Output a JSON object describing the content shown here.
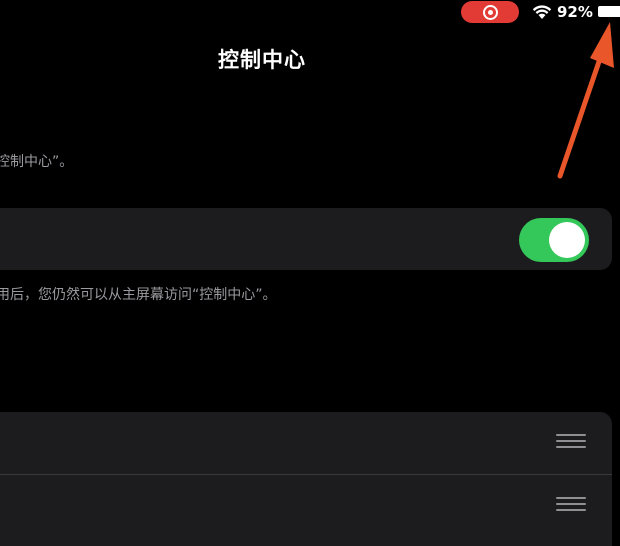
{
  "status_bar": {
    "battery_percent": "92%",
    "recording_color": "#e23a34",
    "icons": [
      "screen-recording-icon",
      "wifi-icon",
      "battery-icon"
    ]
  },
  "header": {
    "title": "控制中心"
  },
  "access_section": {
    "description": "控制中心”。",
    "toggle_on": true,
    "toggle_color": "#34c759",
    "footer": "用后，您仍然可以从主屏幕访问“控制中心”。"
  },
  "list": {
    "rows": [
      {
        "icon": "reorder-icon"
      },
      {
        "icon": "reorder-icon"
      }
    ]
  },
  "annotation": {
    "arrow_color": "#e8562a"
  }
}
